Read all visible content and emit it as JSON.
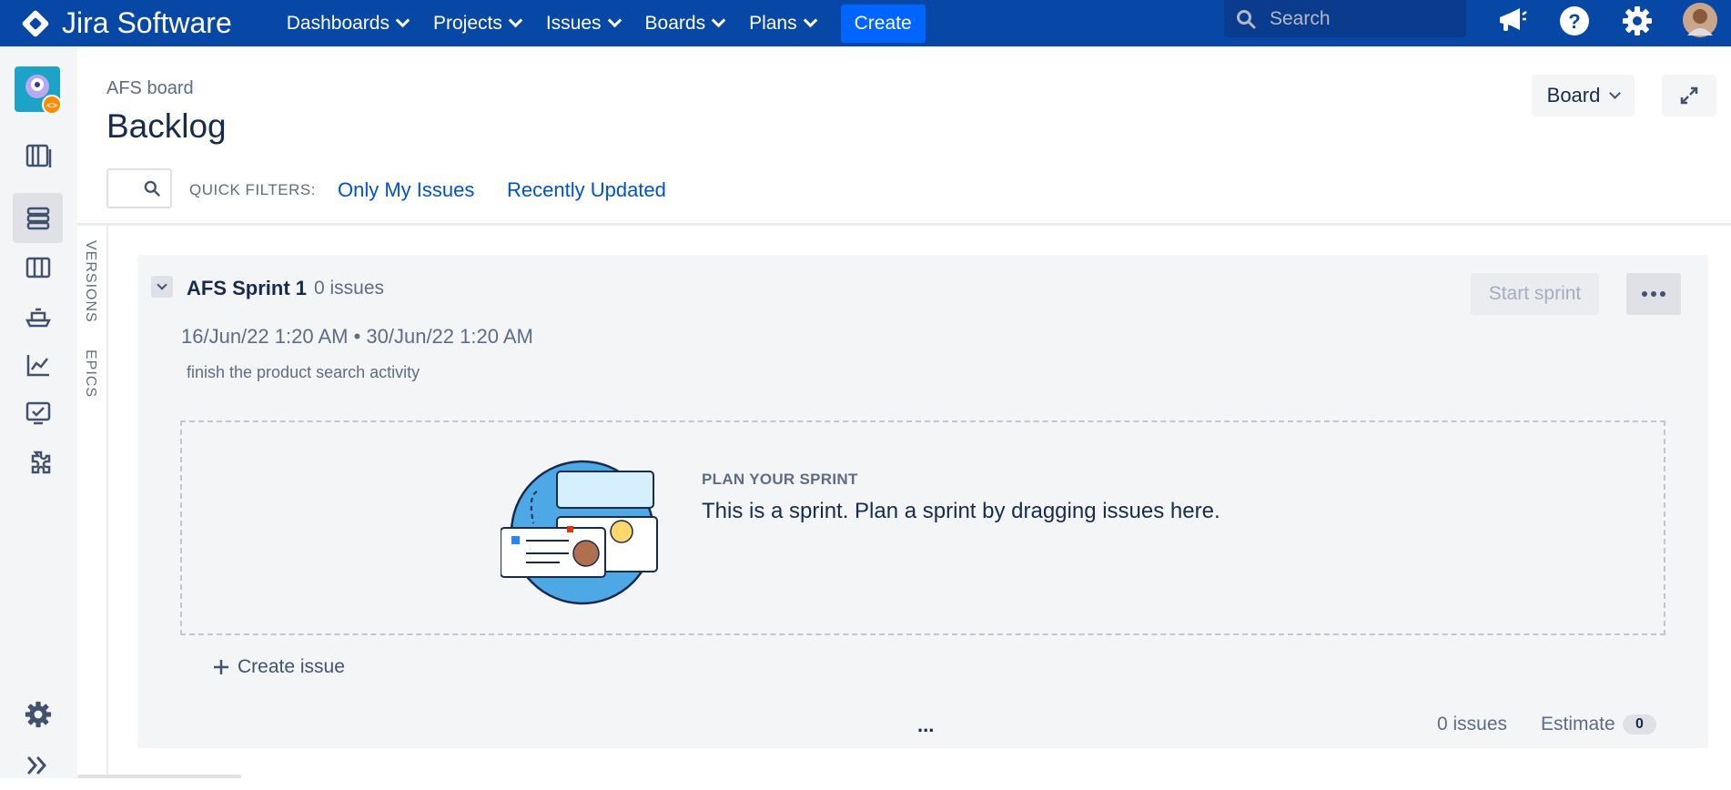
{
  "topnav": {
    "logo_text": "Jira Software",
    "items": [
      {
        "label": "Dashboards"
      },
      {
        "label": "Projects"
      },
      {
        "label": "Issues"
      },
      {
        "label": "Boards"
      },
      {
        "label": "Plans"
      }
    ],
    "create_label": "Create",
    "search_placeholder": "Search",
    "icons": [
      "notifications-megaphone-icon",
      "help-icon",
      "settings-gear-icon",
      "avatar"
    ],
    "brand_color": "#0747a6"
  },
  "sidebar": {
    "icons": [
      "project-avatar-icon",
      "roadmap-icon",
      "backlog-icon",
      "board-icon",
      "releases-icon",
      "reports-icon",
      "issues-icon",
      "apps-icon",
      "project-settings-icon",
      "expand-sidebar-icon"
    ],
    "active": "backlog-icon"
  },
  "header": {
    "breadcrumb": "AFS board",
    "title": "Backlog",
    "board_button": "Board"
  },
  "filters": {
    "label": "QUICK FILTERS:",
    "links": [
      "Only My Issues",
      "Recently Updated"
    ]
  },
  "side_tabs": [
    "VERSIONS",
    "EPICS"
  ],
  "sprint": {
    "name": "AFS Sprint 1",
    "issue_count": "0 issues",
    "start_button": "Start sprint",
    "dates": "16/Jun/22 1:20 AM • 30/Jun/22 1:20 AM",
    "goal": "finish the product search activity",
    "plan_heading": "PLAN YOUR SPRINT",
    "plan_text": "This is a sprint. Plan a sprint by dragging issues here.",
    "create_issue": "Create issue",
    "footer_dots": "...",
    "footer_issues": "0 issues",
    "estimate_label": "Estimate",
    "estimate_value": "0"
  }
}
